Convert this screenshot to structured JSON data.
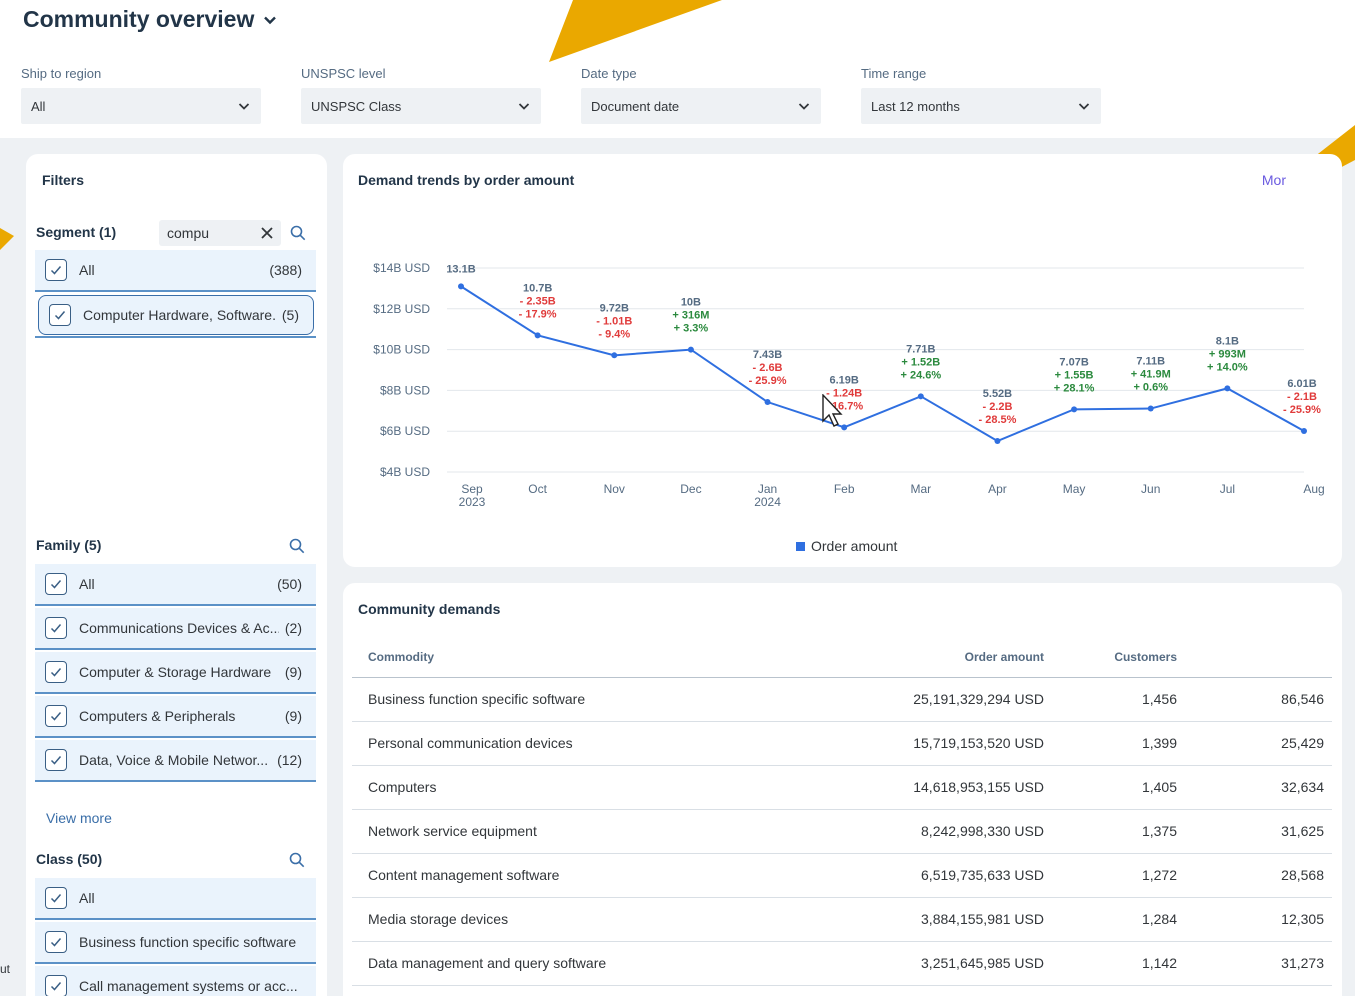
{
  "page": {
    "title": "Community overview",
    "edge_text": "ut"
  },
  "selectors": [
    {
      "label": "Ship to region",
      "value": "All"
    },
    {
      "label": "UNSPSC level",
      "value": "UNSPSC Class"
    },
    {
      "label": "Date type",
      "value": "Document date"
    },
    {
      "label": "Time range",
      "value": "Last 12 months"
    }
  ],
  "filters": {
    "title": "Filters",
    "segment": {
      "title": "Segment (1)",
      "search_value": "compu",
      "items": [
        {
          "label": "All",
          "count": "(388)"
        },
        {
          "label": "Computer Hardware, Software...",
          "count": "(5)"
        }
      ]
    },
    "family": {
      "title": "Family (5)",
      "items": [
        {
          "label": "All",
          "count": "(50)"
        },
        {
          "label": "Communications Devices & Ac...",
          "count": "(2)"
        },
        {
          "label": "Computer & Storage Hardware",
          "count": "(9)"
        },
        {
          "label": "Computers & Peripherals",
          "count": "(9)"
        },
        {
          "label": "Data, Voice & Mobile Networ...",
          "count": "(12)"
        }
      ],
      "view_more": "View more"
    },
    "class": {
      "title": "Class (50)",
      "items": [
        {
          "label": "All",
          "count": ""
        },
        {
          "label": "Business function specific software",
          "count": ""
        },
        {
          "label": "Call management systems or acc...",
          "count": ""
        }
      ]
    }
  },
  "chart_card": {
    "title": "Demand trends by order amount",
    "more_link": "Mor"
  },
  "chart_data": {
    "type": "line",
    "title": "Demand trends by order amount",
    "categories": [
      "Sep\n2023",
      "Oct",
      "Nov",
      "Dec",
      "Jan\n2024",
      "Feb",
      "Mar",
      "Apr",
      "May",
      "Jun",
      "Jul",
      "Aug"
    ],
    "y_ticks": [
      "$4B USD",
      "$6B USD",
      "$8B USD",
      "$10B USD",
      "$12B USD",
      "$14B USD"
    ],
    "ylim": [
      4,
      14
    ],
    "grid": true,
    "legend_position": "bottom-center",
    "series": [
      {
        "name": "Order amount",
        "color": "#2f6fe0",
        "values": [
          13.1,
          10.7,
          9.72,
          10.0,
          7.43,
          6.19,
          7.71,
          5.52,
          7.07,
          7.11,
          8.1,
          6.01
        ],
        "labels": [
          "13.1B",
          "10.7B",
          "9.72B",
          "10B",
          "7.43B",
          "6.19B",
          "7.71B",
          "5.52B",
          "7.07B",
          "7.11B",
          "8.1B",
          "6.01B"
        ],
        "changes": [
          "",
          "- 2.35B",
          "- 1.01B",
          "+ 316M",
          "- 2.6B",
          "- 1.24B",
          "+ 1.52B",
          "- 2.2B",
          "+ 1.55B",
          "+ 41.9M",
          "+ 993M",
          "- 2.1B"
        ],
        "changes_pct": [
          "",
          "- 17.9%",
          "- 9.4%",
          "+ 3.3%",
          "- 25.9%",
          "- 16.7%",
          "+ 24.6%",
          "- 28.5%",
          "+ 28.1%",
          "+ 0.6%",
          "+ 14.0%",
          "- 25.9%"
        ]
      }
    ],
    "colors": {
      "up": "#2b8a3e",
      "down": "#e03b3b",
      "label": "#556b82"
    }
  },
  "table": {
    "title": "Community demands",
    "headers": [
      "Commodity",
      "Order amount",
      "Customers",
      ""
    ],
    "rows": [
      [
        "Business function specific software",
        "25,191,329,294 USD",
        "1,456",
        "86,546"
      ],
      [
        "Personal communication devices",
        "15,719,153,520 USD",
        "1,399",
        "25,429"
      ],
      [
        "Computers",
        "14,618,953,155 USD",
        "1,405",
        "32,634"
      ],
      [
        "Network service equipment",
        "8,242,998,330 USD",
        "1,375",
        "31,625"
      ],
      [
        "Content management software",
        "6,519,735,633 USD",
        "1,272",
        "28,568"
      ],
      [
        "Media storage devices",
        "3,884,155,981 USD",
        "1,284",
        "12,305"
      ],
      [
        "Data management and query software",
        "3,251,645,985 USD",
        "1,142",
        "31,273"
      ]
    ]
  }
}
